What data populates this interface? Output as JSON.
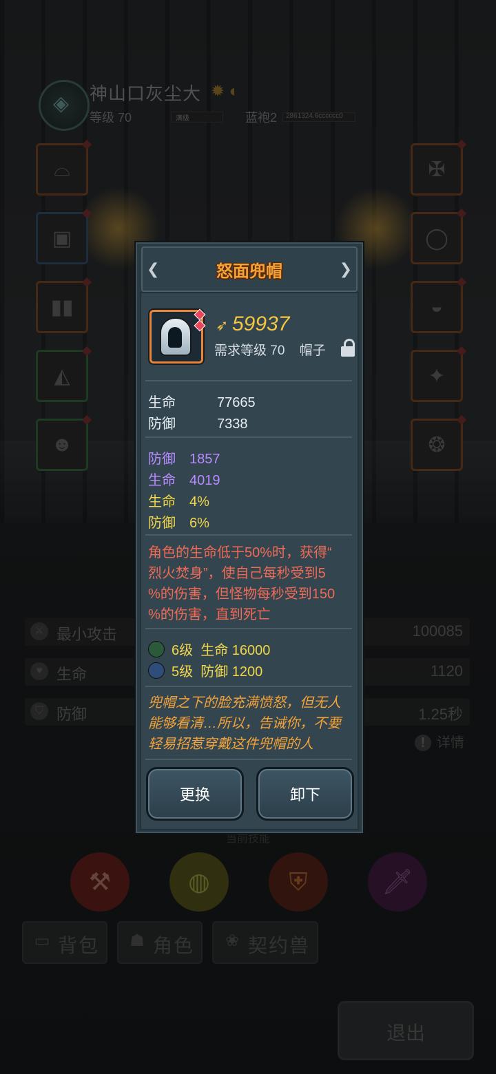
{
  "player": {
    "name": "神山口灰尘大",
    "level": "等级 70",
    "exp_label": "满级",
    "rank": "蓝袍2",
    "rank_progress": "2861324.6cccccc0"
  },
  "equipment_slots": {
    "left": [
      "hood",
      "armor",
      "boots",
      "glove",
      "pet"
    ],
    "right": [
      "weapon",
      "ring",
      "helmet",
      "amulet",
      "orb"
    ]
  },
  "stats": [
    {
      "label": "最小攻击",
      "value": "100085",
      "icon": "sword-icon"
    },
    {
      "label": "生命",
      "value": "1120",
      "icon": "heart-icon"
    },
    {
      "label": "防御",
      "value": "1.25秒",
      "icon": "shield-icon"
    }
  ],
  "detail_link": "详情",
  "skills_label": "当前技能",
  "tabs": [
    {
      "label": "背包",
      "icon": "bag-icon"
    },
    {
      "label": "角色",
      "icon": "character-icon"
    },
    {
      "label": "契约兽",
      "icon": "paw-icon"
    }
  ],
  "exit_label": "退出",
  "item": {
    "name": "怒面兜帽",
    "score": "59937",
    "requirement": "需求等级 70",
    "type": "帽子",
    "base_stats": [
      {
        "label": "生命",
        "value": "77665"
      },
      {
        "label": "防御",
        "value": "7338"
      }
    ],
    "bonus_stats": [
      {
        "label": "防御",
        "value": "1857",
        "color": "#b98bff"
      },
      {
        "label": "生命",
        "value": "4019",
        "color": "#b98bff"
      },
      {
        "label": "生命",
        "value": "4%",
        "color": "#f1d54a"
      },
      {
        "label": "防御",
        "value": "6%",
        "color": "#f1d54a"
      }
    ],
    "special_lines": [
      "角色的生命低于50%时，获得“",
      "烈火焚身”，使自己每秒受到5",
      "%的伤害，但怪物每秒受到150",
      "%的伤害，直到死亡"
    ],
    "set_bonuses": [
      {
        "level": "6级",
        "bonus": "生命 16000"
      },
      {
        "level": "5级",
        "bonus": "防御 1200"
      }
    ],
    "lore_lines": [
      "兜帽之下的脸充满愤怒，但无人",
      "能够看清…所以，告诫你，不要",
      "轻易招惹穿戴这件兜帽的人"
    ],
    "replace_label": "更换",
    "unequip_label": "卸下"
  }
}
